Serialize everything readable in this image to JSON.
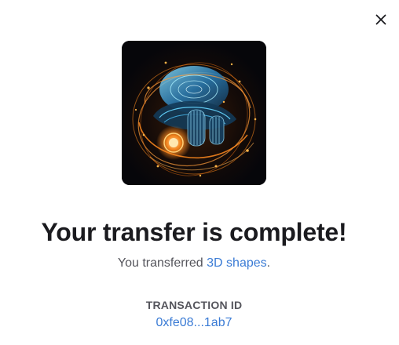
{
  "dialog": {
    "close_icon": "close-icon",
    "image": {
      "alt": "3D shapes",
      "colors": {
        "background": "#07070b",
        "orange": "#ff8a1e",
        "cyan": "#3fb6ff"
      }
    },
    "title": "Your transfer is complete!",
    "subtitle_prefix": "You transferred ",
    "item_link": "3D shapes",
    "subtitle_suffix": ".",
    "transaction_label": "TRANSACTION ID",
    "transaction_id": "0xfe08...1ab7"
  },
  "colors": {
    "link": "#3a7bd5",
    "text_primary": "#1b1b1f",
    "text_secondary": "#55555c"
  }
}
